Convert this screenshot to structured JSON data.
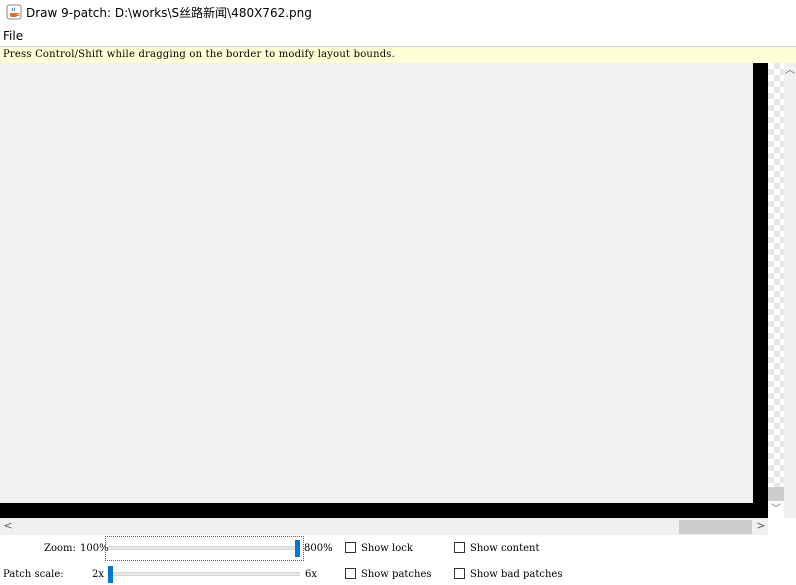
{
  "window": {
    "title": "Draw 9-patch: D:\\works\\S丝路新闻\\480X762.png"
  },
  "menu": {
    "file_label": "File"
  },
  "hint": {
    "text": "Press Control/Shift while dragging on the border to modify layout bounds."
  },
  "controls": {
    "zoom": {
      "label": "Zoom:",
      "min_label": "100%",
      "max_label": "800%",
      "value_percent": 800
    },
    "patch_scale": {
      "label": "Patch scale:",
      "min_label": "2x",
      "max_label": "6x",
      "value": 2
    },
    "show_lock": {
      "label": "Show lock",
      "checked": false
    },
    "show_content": {
      "label": "Show content",
      "checked": false
    },
    "show_patches": {
      "label": "Show patches",
      "checked": false
    },
    "show_bad_patches": {
      "label": "Show bad patches",
      "checked": false
    }
  },
  "colors": {
    "canvas": "#f2f0f1",
    "border": "#000000",
    "hint_bg": "#fefed6",
    "slider_accent": "#0078d7"
  },
  "icons": {
    "app": "java-coffee-cup-icon"
  }
}
